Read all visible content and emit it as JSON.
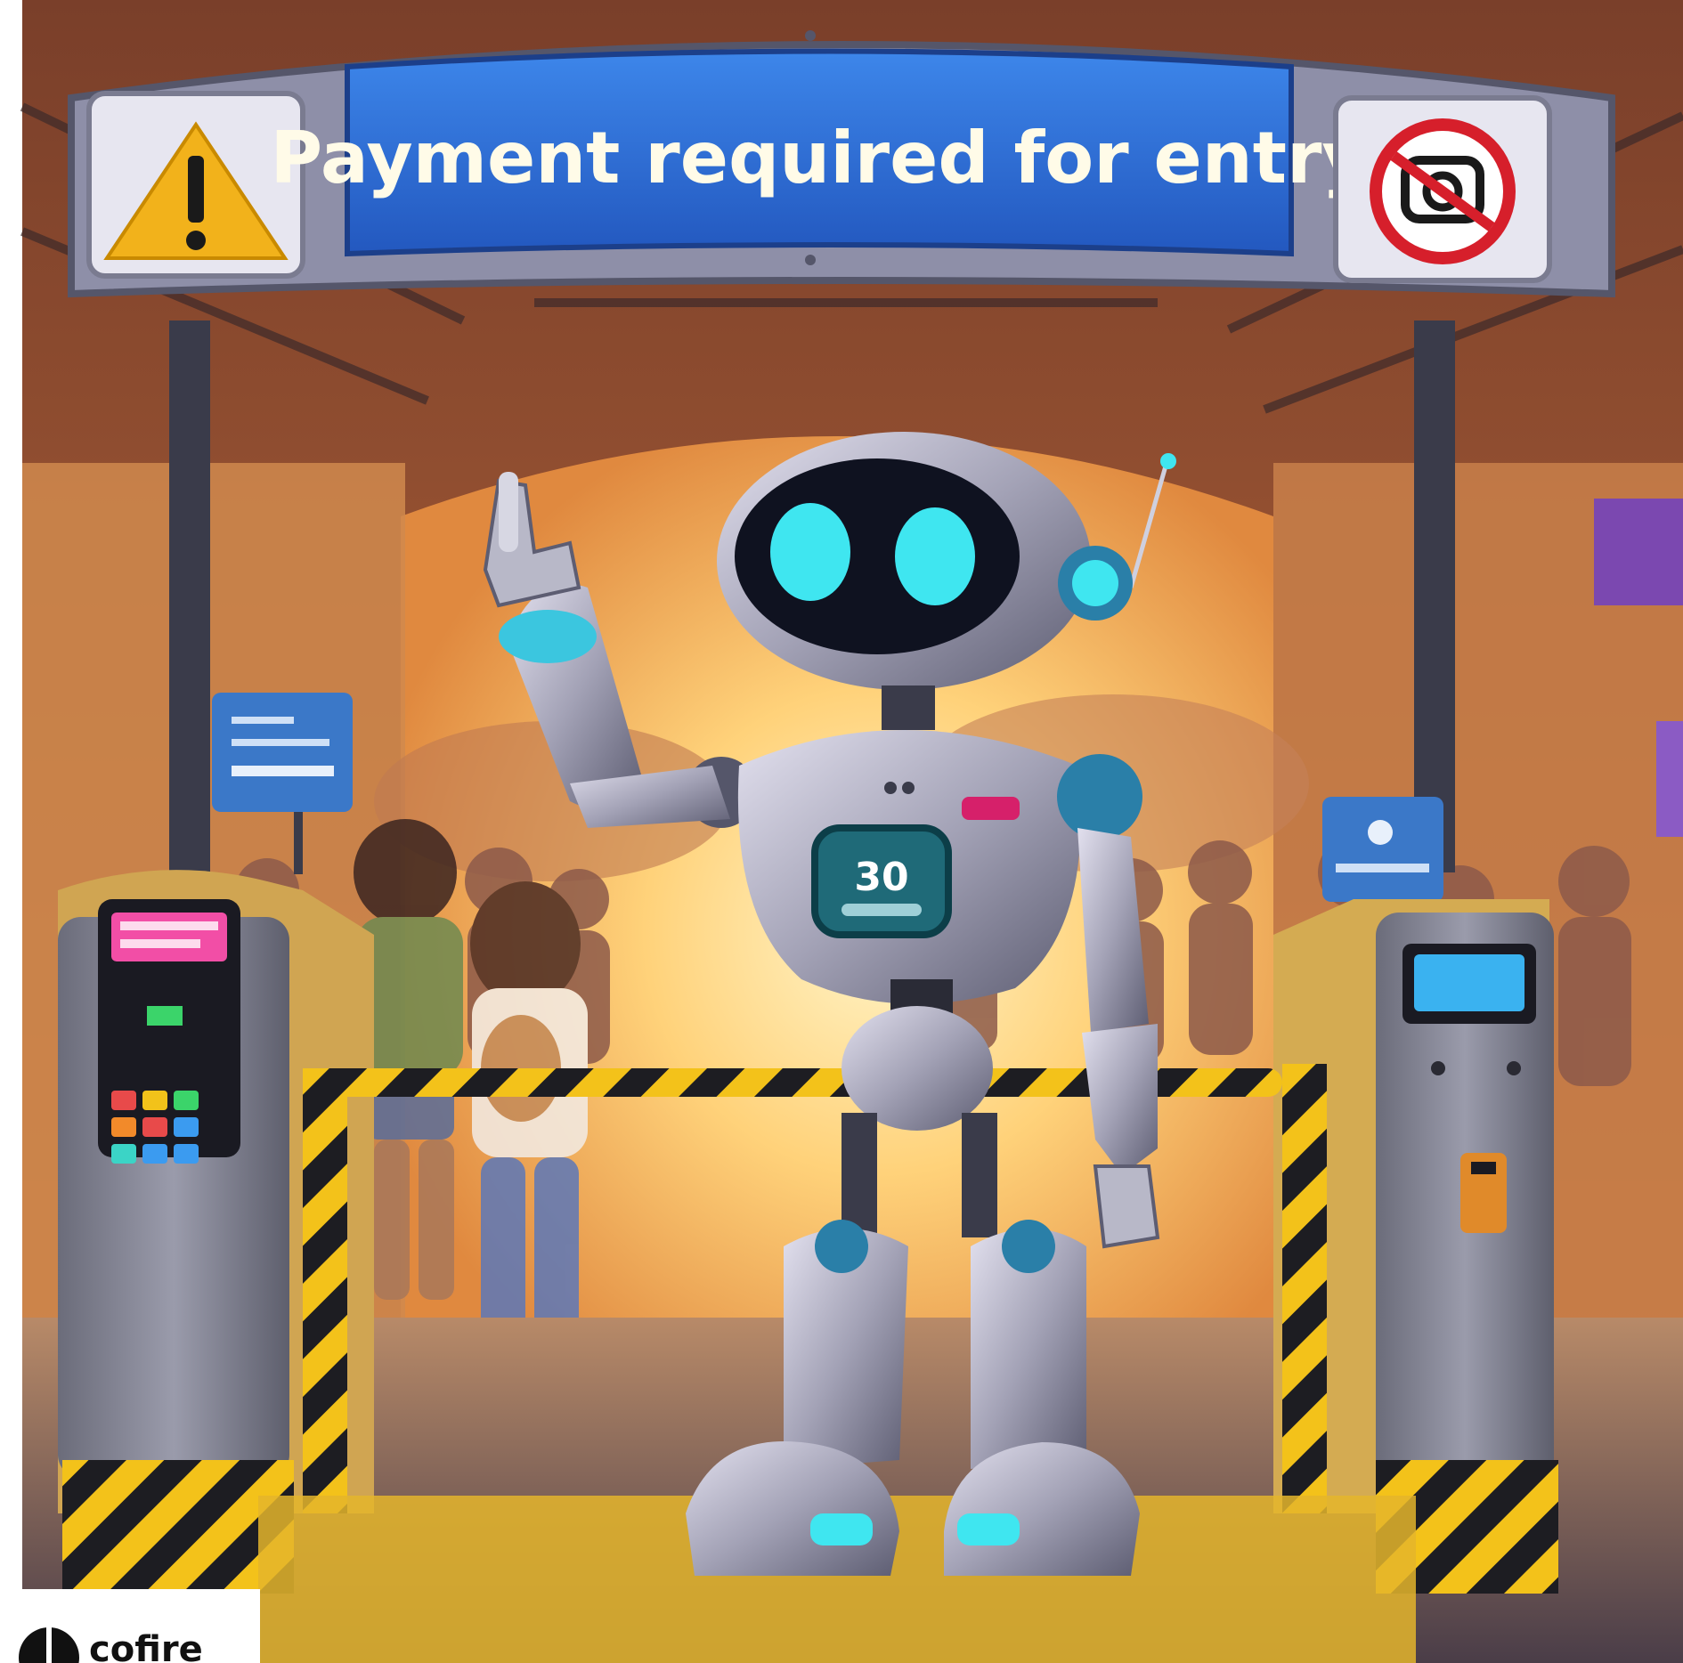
{
  "banner": {
    "text": "Payment required for entry"
  },
  "robot": {
    "chest_number": "30"
  },
  "watermark": {
    "text": "cofire"
  },
  "colors": {
    "banner_blue": "#2f6fd6",
    "banner_frame": "#8e8fa8",
    "warning_yellow": "#f2b21b",
    "no_sign_red": "#d61f2b",
    "robot_silver": "#a9a9b8",
    "robot_eye_cyan": "#3fe6f0",
    "hazard_yellow": "#f3c21a",
    "hazard_black": "#1d1d22",
    "kiosk_gray": "#7d7e8c",
    "sky_glow": "#ffd98a"
  },
  "icons": {
    "left_sign": "warning-icon",
    "right_sign": "no-camera-icon"
  }
}
